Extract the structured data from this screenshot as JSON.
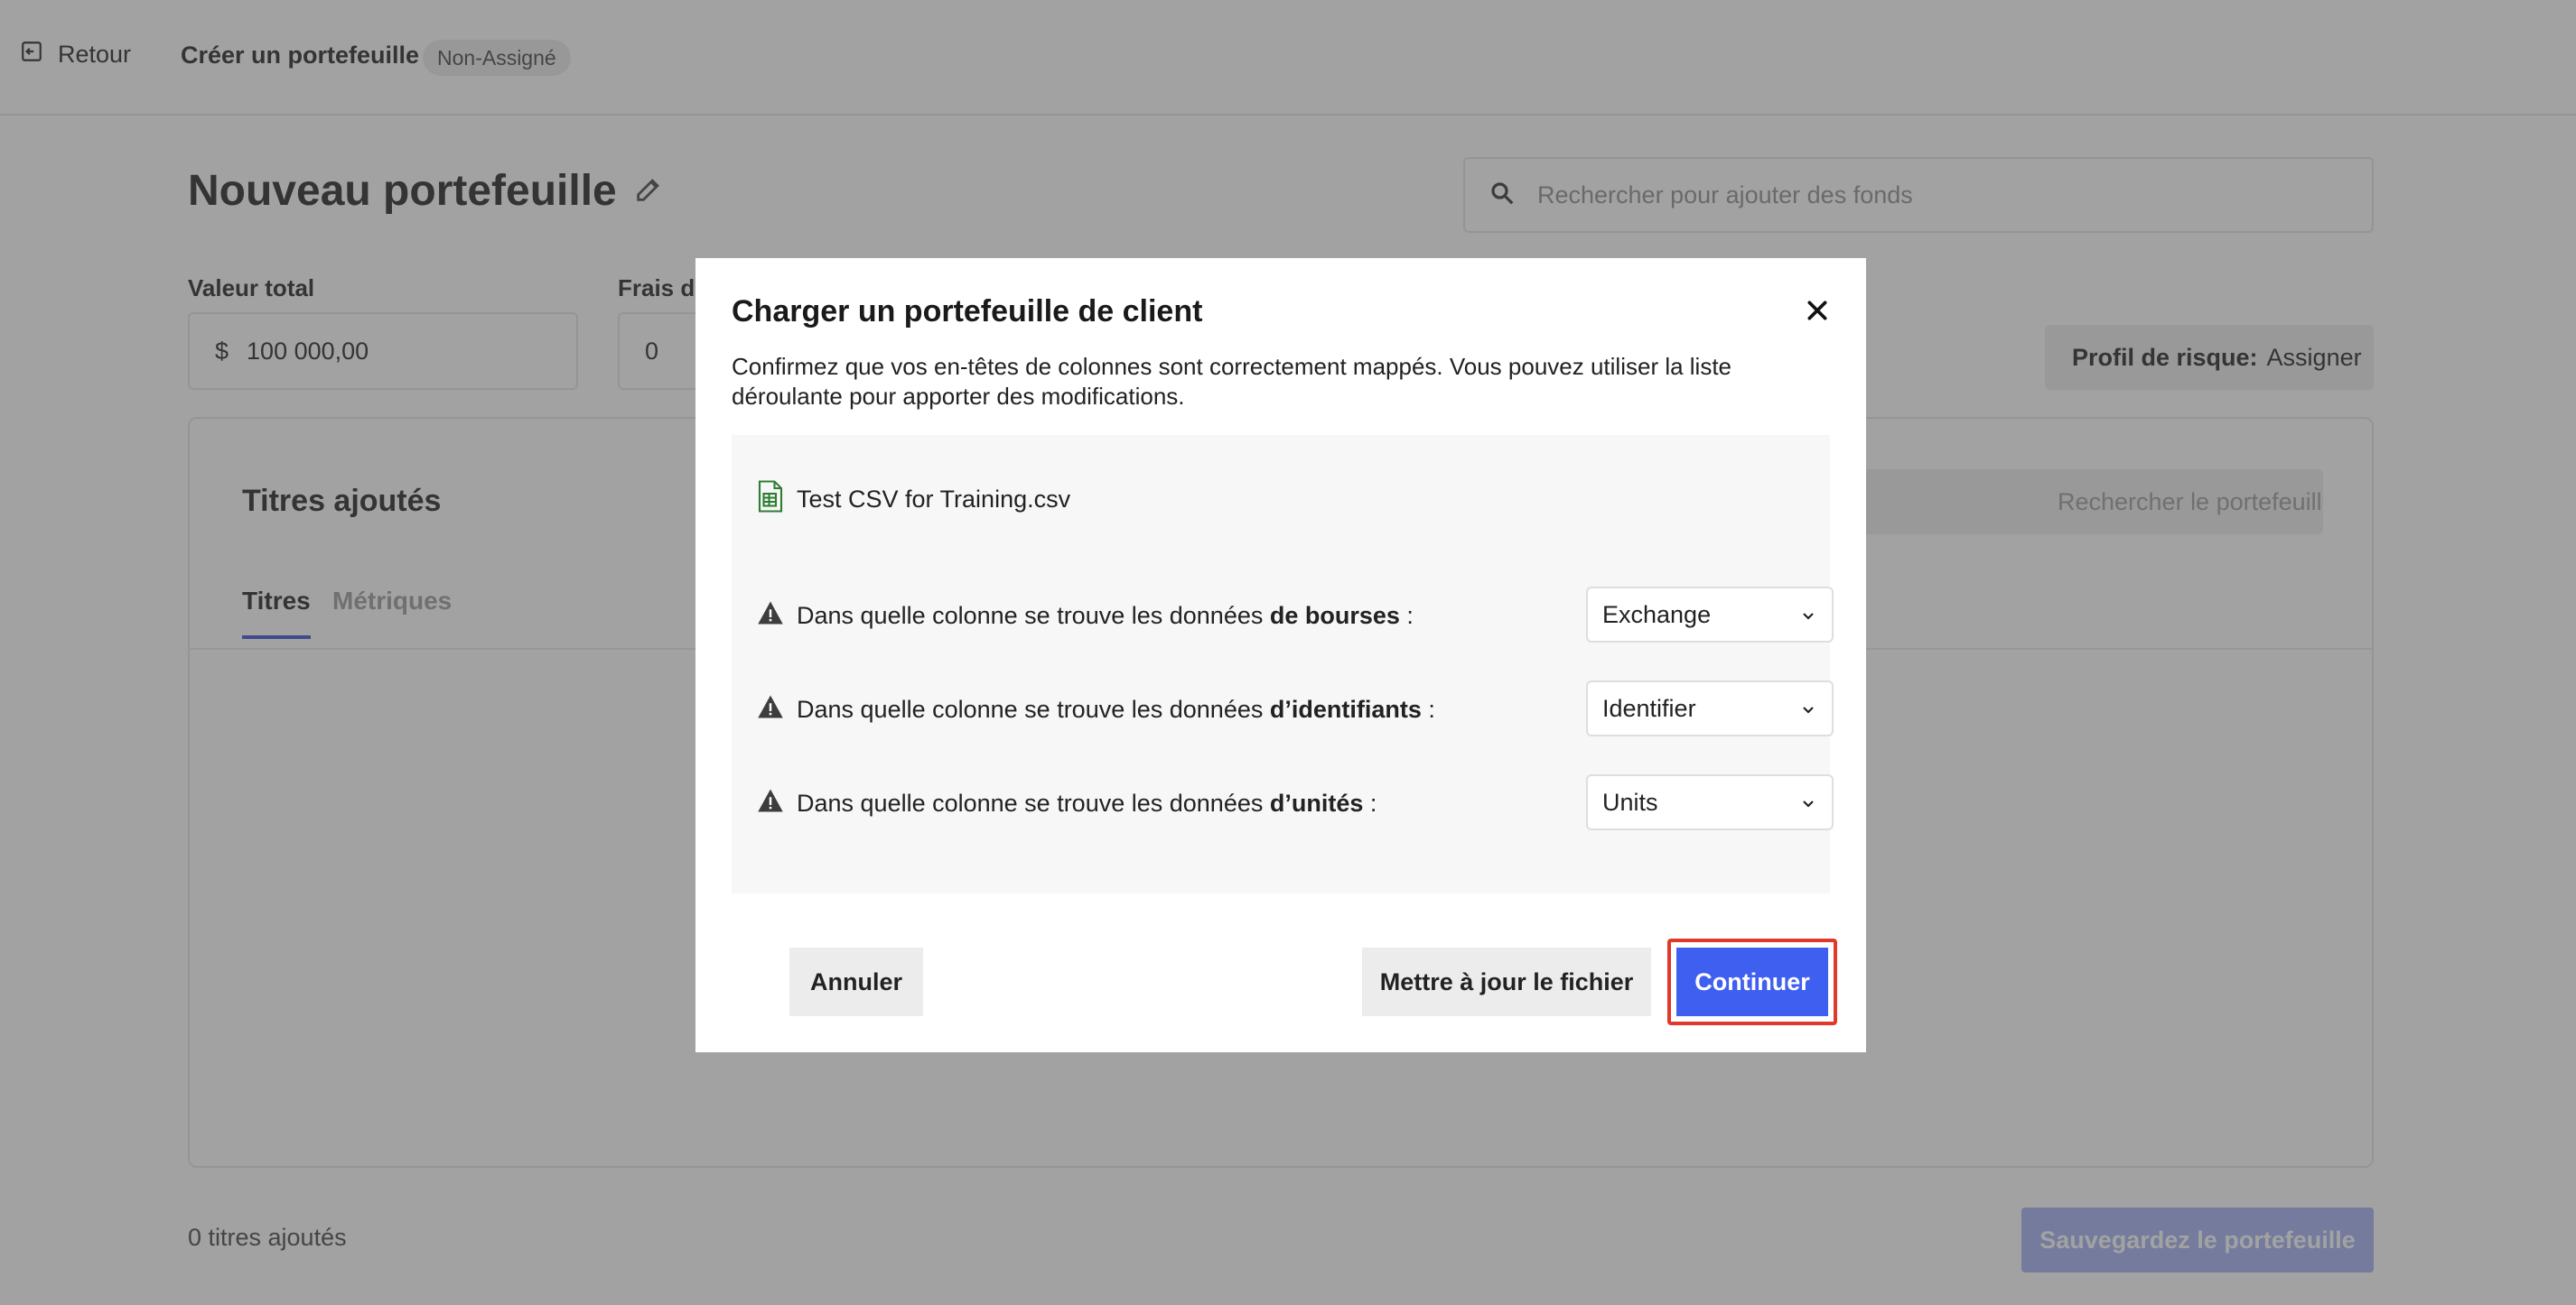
{
  "header": {
    "back_label": "Retour",
    "title": "Créer un portefeuille",
    "badge": "Non-Assigné"
  },
  "page": {
    "title": "Nouveau portefeuille",
    "fund_search_placeholder": "Rechercher pour ajouter des fonds",
    "total_value_label": "Valeur total",
    "total_value_currency": "$",
    "total_value": "100 000,00",
    "fees_label": "Frais de",
    "fees_value": "0",
    "risk_label": "Profil de risque:",
    "risk_value": "Assigner"
  },
  "card": {
    "title": "Titres ajoutés",
    "tabs": [
      {
        "label": "Titres",
        "active": true
      },
      {
        "label": "Métriques",
        "active": false
      }
    ],
    "search_placeholder": "Rechercher le portefeuille"
  },
  "footer": {
    "count_text": "0 titres ajoutés",
    "save_label": "Sauvegardez le portefeuille"
  },
  "modal": {
    "title": "Charger un portefeuille de client",
    "description": "Confirmez que vos en-têtes de colonnes sont correctement mappés. Vous pouvez utiliser la liste déroulante pour apporter des modifications.",
    "file_name": "Test CSV for Training.csv",
    "mappings": [
      {
        "prefix": "Dans quelle colonne se trouve les données ",
        "field": "de bourses",
        "suffix": " :",
        "selected": "Exchange"
      },
      {
        "prefix": "Dans quelle colonne se trouve les données ",
        "field": "d’identifiants",
        "suffix": " :",
        "selected": "Identifier"
      },
      {
        "prefix": "Dans quelle colonne se trouve les données ",
        "field": "d’unités",
        "suffix": " :",
        "selected": "Units"
      }
    ],
    "cancel_label": "Annuler",
    "update_label": "Mettre à jour le fichier",
    "continue_label": "Continuer"
  },
  "colors": {
    "primary": "#3f5ff0",
    "primary_disabled": "#a3b0f5",
    "highlight": "#e0382b",
    "warning_icon": "#3d3d3d"
  }
}
